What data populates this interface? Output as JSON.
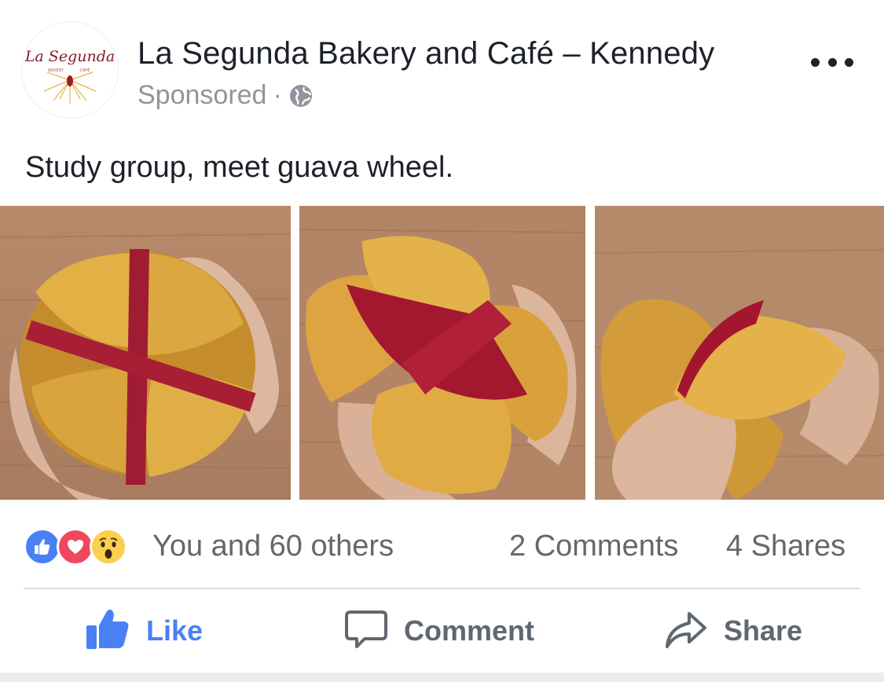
{
  "post": {
    "page_name": "La Segunda Bakery and Café – Kennedy",
    "sponsored_label": "Sponsored",
    "separator": "·",
    "privacy_icon": "globe-icon",
    "more_icon": "more-options-icon",
    "caption": "Study group, meet guava wheel.",
    "logo": {
      "wordmark": "La Segunda",
      "sub_left": "BAKERY",
      "sub_right": "CAFÉ"
    }
  },
  "photos": [
    {
      "name": "guava-wheel-photo-1"
    },
    {
      "name": "guava-wheel-photo-2"
    },
    {
      "name": "guava-wheel-photo-3"
    }
  ],
  "engagement": {
    "reaction_icons": [
      "like-reaction-icon",
      "love-reaction-icon",
      "wow-reaction-icon"
    ],
    "reaction_summary": "You and 60 others",
    "comments": "2 Comments",
    "shares": "4 Shares"
  },
  "actions": {
    "like_label": "Like",
    "comment_label": "Comment",
    "share_label": "Share"
  },
  "colors": {
    "facebook_blue": "#4a80f5",
    "love_red": "#f0475f",
    "wow_yellow": "#fcd04f",
    "muted_text": "#65676b"
  }
}
